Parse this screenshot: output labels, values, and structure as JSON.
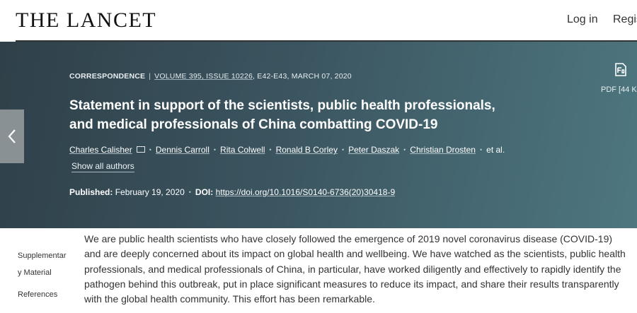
{
  "header": {
    "logo": "THE LANCET",
    "login": "Log in",
    "register": "Regis"
  },
  "article_meta": {
    "type": "CORRESPONDENCE",
    "volume": "VOLUME 395, ISSUE 10226",
    "pages_date": ", E42-E43, MARCH 07, 2020"
  },
  "title": "Statement in support of the scientists, public health professionals, and medical professionals of China combatting COVID-19",
  "authors": [
    "Charles Calisher",
    "Dennis Carroll",
    "Rita Colwell",
    "Ronald B Corley",
    "Peter Daszak",
    "Christian Drosten"
  ],
  "et_al": "et al.",
  "show_all_authors": "Show all authors",
  "published": {
    "label": "Published:",
    "date": "February 19, 2020",
    "doi_label": "DOI:",
    "doi": "https://doi.org/10.1016/S0140-6736(20)30418-9"
  },
  "pdf": {
    "label": "PDF [44 K"
  },
  "sidenav": {
    "supplementary_line1": "Supplementar",
    "supplementary_line2": "y Material",
    "references": "References"
  },
  "body_text": "We are public health scientists who have closely followed the emergence of 2019 novel coronavirus disease (COVID-19) and are deeply concerned about its impact on global health and wellbeing. We have watched as the scientists, public health professionals, and medical professionals of China, in particular, have worked diligently and effectively to rapidly identify the pathogen behind this outbreak, put in place significant measures to reduce its impact, and share their results transparently with the global health community. This effort has been remarkable.",
  "icons": {
    "pdf": "pdf-icon",
    "mail": "mail-icon",
    "prev": "chevron-left-icon"
  }
}
